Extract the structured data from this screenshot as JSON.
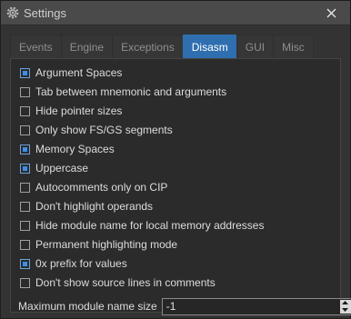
{
  "window": {
    "title": "Settings",
    "icon": "gear-icon",
    "close_icon": "close-icon"
  },
  "tabs": [
    {
      "label": "Events",
      "active": false
    },
    {
      "label": "Engine",
      "active": false
    },
    {
      "label": "Exceptions",
      "active": false
    },
    {
      "label": "Disasm",
      "active": true
    },
    {
      "label": "GUI",
      "active": false
    },
    {
      "label": "Misc",
      "active": false
    }
  ],
  "options": [
    {
      "label": "Argument Spaces",
      "checked": true
    },
    {
      "label": "Tab between mnemonic and arguments",
      "checked": false
    },
    {
      "label": "Hide pointer sizes",
      "checked": false
    },
    {
      "label": "Only show FS/GS segments",
      "checked": false
    },
    {
      "label": "Memory Spaces",
      "checked": true
    },
    {
      "label": "Uppercase",
      "checked": true
    },
    {
      "label": "Autocomments only on CIP",
      "checked": false
    },
    {
      "label": "Don't highlight operands",
      "checked": false
    },
    {
      "label": "Hide module name for local memory addresses",
      "checked": false
    },
    {
      "label": "Permanent highlighting mode",
      "checked": false
    },
    {
      "label": "0x prefix for values",
      "checked": true
    },
    {
      "label": "Don't show source lines in comments",
      "checked": false
    }
  ],
  "max_module_name": {
    "label": "Maximum module name size",
    "value": "-1"
  },
  "colors": {
    "accent": "#2f6fb0",
    "checkbox_fill": "#3d8ee6"
  }
}
